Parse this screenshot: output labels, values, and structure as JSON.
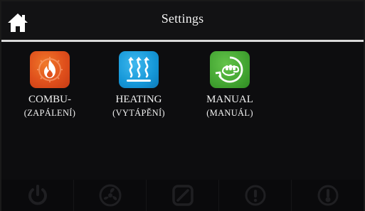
{
  "header": {
    "title": "Settings",
    "home_icon": "home-icon"
  },
  "tiles": [
    {
      "label": "COMBU-",
      "sublabel": "(ZAPÁLENÍ)",
      "icon": "flame-gear-icon",
      "color": "#e0501c"
    },
    {
      "label": "HEATING",
      "sublabel": "(VYTÁPĚNÍ)",
      "icon": "heat-waves-icon",
      "color": "#1597d8"
    },
    {
      "label": "MANUAL",
      "sublabel": "(MANUÁL)",
      "icon": "manual-hand-icon",
      "color": "#43a532"
    }
  ],
  "bottom_bar": {
    "buttons": [
      "power-icon",
      "fan-icon",
      "no-entry-icon",
      "info-icon",
      "thermometer-icon"
    ]
  }
}
